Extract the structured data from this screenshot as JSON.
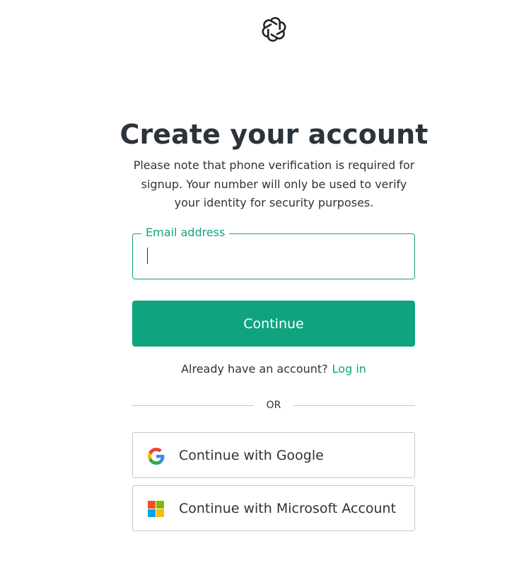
{
  "brand": {
    "logo_icon": "openai-logo-icon",
    "accent_color": "#10a37f",
    "text_color": "#2d333a",
    "border_color": "#c2c8d0"
  },
  "header": {
    "title": "Create your account",
    "subtitle": "Please note that phone verification is required for signup. Your number will only be used to verify your identity for security purposes."
  },
  "form": {
    "email_label": "Email address",
    "email_value": "",
    "continue_label": "Continue"
  },
  "login": {
    "prompt": "Already have an account?",
    "link_label": "Log in"
  },
  "divider": {
    "label": "OR"
  },
  "social": [
    {
      "label": "Continue with Google",
      "icon": "google-icon"
    },
    {
      "label": "Continue with Microsoft Account",
      "icon": "microsoft-icon"
    }
  ]
}
